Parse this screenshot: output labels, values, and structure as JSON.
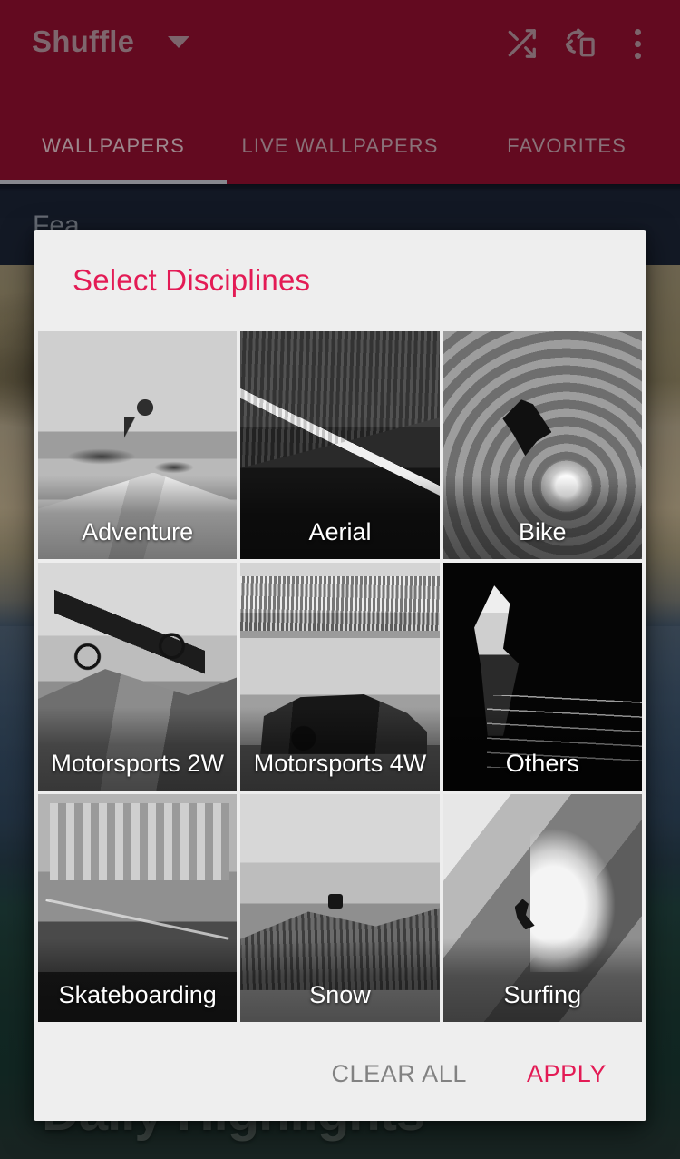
{
  "app_bar": {
    "title": "Shuffle",
    "dropdown_icon": "chevron-down-icon",
    "actions": [
      {
        "name": "shuffle-icon",
        "label": "Shuffle"
      },
      {
        "name": "rotate-device-icon",
        "label": "Auto rotate"
      },
      {
        "name": "overflow-menu-icon",
        "label": "More options"
      }
    ]
  },
  "tabs": [
    {
      "label": "WALLPAPERS",
      "active": true
    },
    {
      "label": "LIVE WALLPAPERS",
      "active": false
    },
    {
      "label": "FAVORITES",
      "active": false
    }
  ],
  "background": {
    "headline": "Daily Highlights",
    "subline": "",
    "fragment": "Fea"
  },
  "dialog": {
    "title": "Select Disciplines",
    "tiles": [
      {
        "label": "Adventure",
        "photo": "ph-adventure",
        "selected": false
      },
      {
        "label": "Aerial",
        "photo": "ph-aerial",
        "selected": false
      },
      {
        "label": "Bike",
        "photo": "ph-bike",
        "selected": false
      },
      {
        "label": "Motorsports 2W",
        "photo": "ph-moto2w",
        "selected": false
      },
      {
        "label": "Motorsports 4W",
        "photo": "ph-moto4w",
        "selected": false
      },
      {
        "label": "Others",
        "photo": "ph-others",
        "selected": false
      },
      {
        "label": "Skateboarding",
        "photo": "ph-skate",
        "selected": false
      },
      {
        "label": "Snow",
        "photo": "ph-snow",
        "selected": false
      },
      {
        "label": "Surfing",
        "photo": "ph-surf",
        "selected": false
      }
    ],
    "actions": {
      "clear_all": "CLEAR ALL",
      "apply": "APPLY"
    }
  },
  "colors": {
    "app_bar": "#7c0d29",
    "accent": "#e31b55",
    "dialog_bg": "#eeeeee",
    "tab_inactive": "#ac8e96",
    "tab_active": "#c4a9b0",
    "clear_all": "#828282"
  }
}
